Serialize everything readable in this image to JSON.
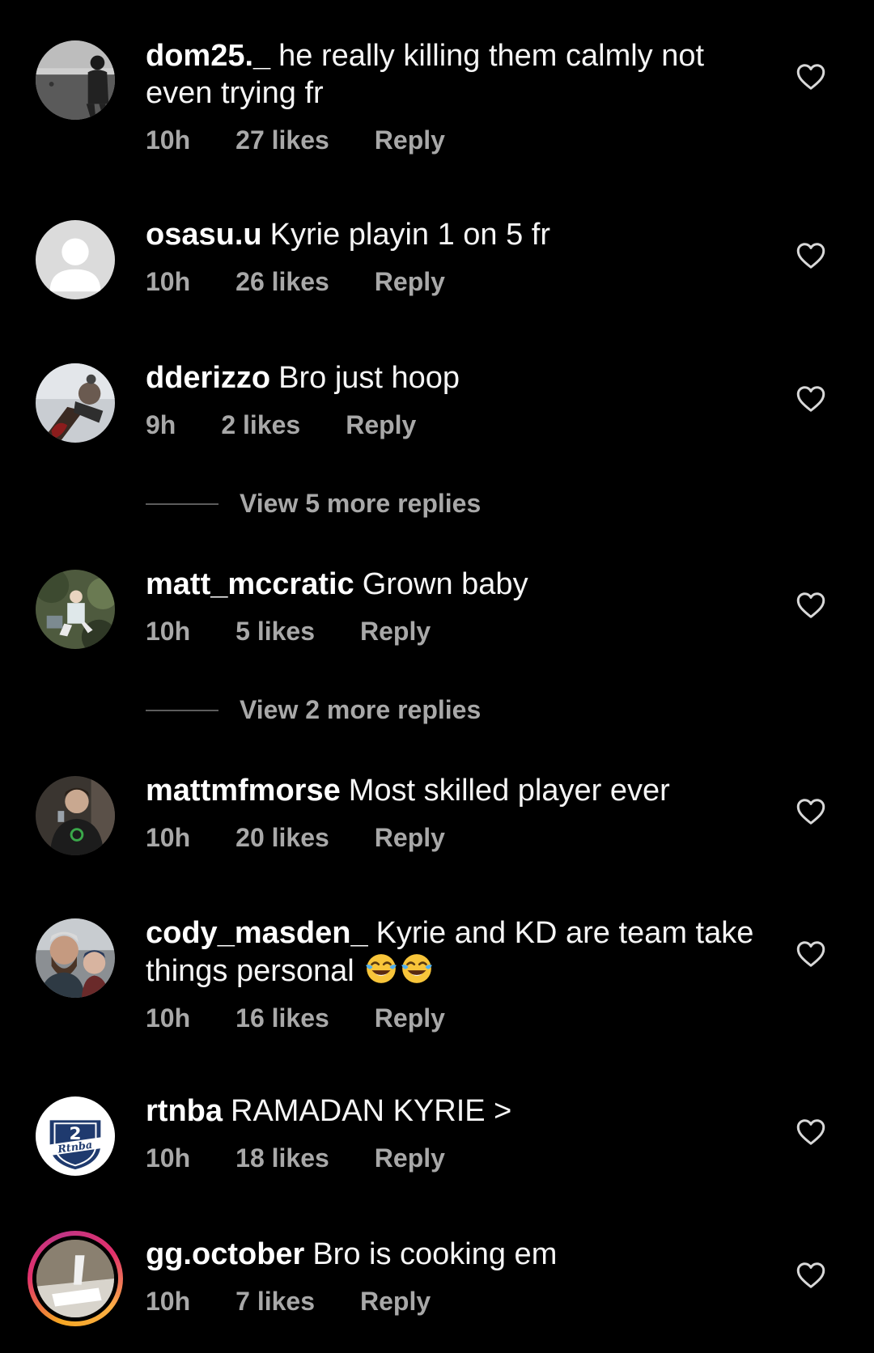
{
  "comments": [
    {
      "username": "dom25._",
      "text": "he really killing them calmly not even trying fr",
      "time": "10h",
      "likes": "27 likes",
      "reply": "Reply"
    },
    {
      "username": "osasu.u",
      "text": "Kyrie playin 1 on 5 fr",
      "time": "10h",
      "likes": "26 likes",
      "reply": "Reply"
    },
    {
      "username": "dderizzo",
      "text": "Bro just hoop",
      "time": "9h",
      "likes": "2 likes",
      "reply": "Reply",
      "view_replies": "View 5 more replies"
    },
    {
      "username": "matt_mccratic",
      "text": "Grown baby",
      "time": "10h",
      "likes": "5 likes",
      "reply": "Reply",
      "view_replies": "View 2 more replies"
    },
    {
      "username": "mattmfmorse",
      "text": "Most skilled player ever",
      "time": "10h",
      "likes": "20 likes",
      "reply": "Reply"
    },
    {
      "username": "cody_masden_",
      "text": "Kyrie and KD are team take things personal",
      "emoji": [
        "face-with-tears-of-joy",
        "face-with-tears-of-joy"
      ],
      "time": "10h",
      "likes": "16 likes",
      "reply": "Reply"
    },
    {
      "username": "rtnba",
      "text": "RAMADAN KYRIE >",
      "time": "10h",
      "likes": "18 likes",
      "reply": "Reply",
      "avatar_logo_text": "Rtnba"
    },
    {
      "username": "gg.october",
      "text": "Bro is cooking em",
      "time": "10h",
      "likes": "7 likes",
      "reply": "Reply",
      "has_story": true
    }
  ],
  "icons": {
    "like": "heart-outline-icon",
    "default_avatar": "default-avatar-icon"
  },
  "colors": {
    "background": "#000000",
    "text": "#f5f5f5",
    "secondary": "#a8a8a8",
    "story_ring": [
      "#f5a623",
      "#e1306c",
      "#c13584"
    ]
  }
}
